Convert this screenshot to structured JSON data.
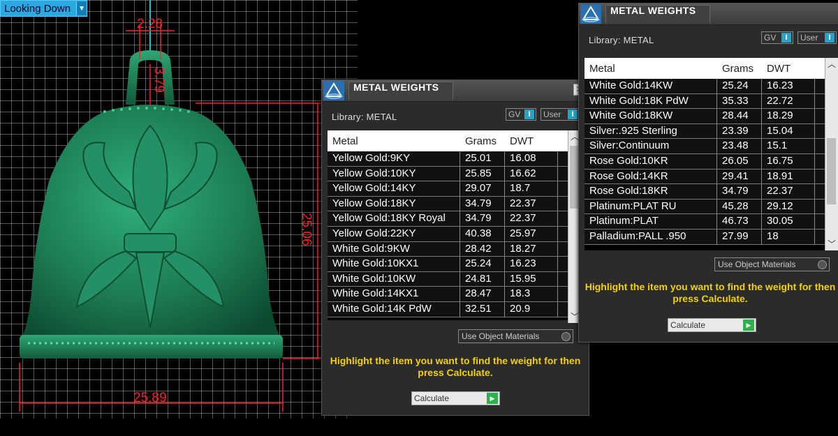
{
  "viewport": {
    "view_label": "Looking Down",
    "dimensions": [
      "2.28",
      "3.79",
      "25.06",
      "25.89"
    ]
  },
  "panels": [
    {
      "title": "METAL WEIGHTS",
      "library": "Library: METAL",
      "gv_label": "GV",
      "user_label": "User",
      "columns": [
        "Metal",
        "Grams",
        "DWT"
      ],
      "rows": [
        [
          "Yellow Gold:9KY",
          "25.01",
          "16.08"
        ],
        [
          "Yellow Gold:10KY",
          "25.85",
          "16.62"
        ],
        [
          "Yellow Gold:14KY",
          "29.07",
          "18.7"
        ],
        [
          "Yellow Gold:18KY",
          "34.79",
          "22.37"
        ],
        [
          "Yellow Gold:18KY Royal",
          "34.79",
          "22.37"
        ],
        [
          "Yellow Gold:22KY",
          "40.38",
          "25.97"
        ],
        [
          "White Gold:9KW",
          "28.42",
          "18.27"
        ],
        [
          "White Gold:10KX1",
          "25.24",
          "16.23"
        ],
        [
          "White Gold:10KW",
          "24.81",
          "15.95"
        ],
        [
          "White Gold:14KX1",
          "28.47",
          "18.3"
        ],
        [
          "White Gold:14K PdW",
          "32.51",
          "20.9"
        ]
      ],
      "use_object_materials": "Use Object Materials",
      "hint": "Highlight the item you want to find the weight for then press Calculate.",
      "calculate": "Calculate"
    },
    {
      "title": "METAL WEIGHTS",
      "library": "Library: METAL",
      "gv_label": "GV",
      "user_label": "User",
      "columns": [
        "Metal",
        "Grams",
        "DWT"
      ],
      "rows": [
        [
          "White Gold:14KW",
          "25.24",
          "16.23"
        ],
        [
          "White Gold:18K PdW",
          "35.33",
          "22.72"
        ],
        [
          "White Gold:18KW",
          "28.44",
          "18.29"
        ],
        [
          "Silver:.925 Sterling",
          "23.39",
          "15.04"
        ],
        [
          "Silver:Continuum",
          "23.48",
          "15.1"
        ],
        [
          "Rose Gold:10KR",
          "26.05",
          "16.75"
        ],
        [
          "Rose Gold:14KR",
          "29.41",
          "18.91"
        ],
        [
          "Rose Gold:18KR",
          "34.79",
          "22.37"
        ],
        [
          "Platinum:PLAT RU",
          "45.28",
          "29.12"
        ],
        [
          "Platinum:PLAT",
          "46.73",
          "30.05"
        ],
        [
          "Palladium:PALL .950",
          "27.99",
          "18"
        ]
      ],
      "use_object_materials": "Use Object Materials",
      "hint": "Highlight the item you want to find the weight for then press Calculate.",
      "calculate": "Calculate"
    }
  ],
  "colors": {
    "model": "#1f8a5c",
    "dimension": "#ff2020",
    "hint": "#f2d200",
    "accent": "#2aa3c9"
  }
}
